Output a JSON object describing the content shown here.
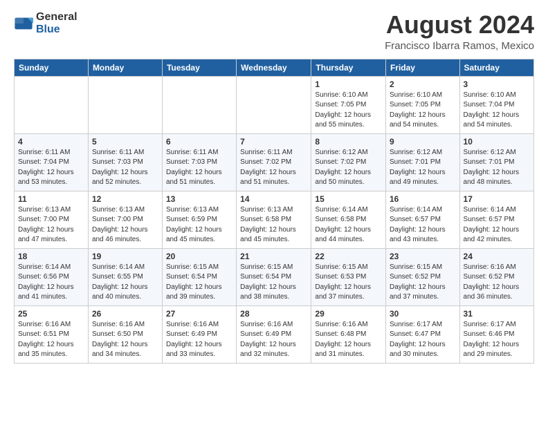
{
  "logo": {
    "general": "General",
    "blue": "Blue"
  },
  "title": "August 2024",
  "subtitle": "Francisco Ibarra Ramos, Mexico",
  "headers": [
    "Sunday",
    "Monday",
    "Tuesday",
    "Wednesday",
    "Thursday",
    "Friday",
    "Saturday"
  ],
  "weeks": [
    [
      {
        "day": "",
        "info": ""
      },
      {
        "day": "",
        "info": ""
      },
      {
        "day": "",
        "info": ""
      },
      {
        "day": "",
        "info": ""
      },
      {
        "day": "1",
        "info": "Sunrise: 6:10 AM\nSunset: 7:05 PM\nDaylight: 12 hours\nand 55 minutes."
      },
      {
        "day": "2",
        "info": "Sunrise: 6:10 AM\nSunset: 7:05 PM\nDaylight: 12 hours\nand 54 minutes."
      },
      {
        "day": "3",
        "info": "Sunrise: 6:10 AM\nSunset: 7:04 PM\nDaylight: 12 hours\nand 54 minutes."
      }
    ],
    [
      {
        "day": "4",
        "info": "Sunrise: 6:11 AM\nSunset: 7:04 PM\nDaylight: 12 hours\nand 53 minutes."
      },
      {
        "day": "5",
        "info": "Sunrise: 6:11 AM\nSunset: 7:03 PM\nDaylight: 12 hours\nand 52 minutes."
      },
      {
        "day": "6",
        "info": "Sunrise: 6:11 AM\nSunset: 7:03 PM\nDaylight: 12 hours\nand 51 minutes."
      },
      {
        "day": "7",
        "info": "Sunrise: 6:11 AM\nSunset: 7:02 PM\nDaylight: 12 hours\nand 51 minutes."
      },
      {
        "day": "8",
        "info": "Sunrise: 6:12 AM\nSunset: 7:02 PM\nDaylight: 12 hours\nand 50 minutes."
      },
      {
        "day": "9",
        "info": "Sunrise: 6:12 AM\nSunset: 7:01 PM\nDaylight: 12 hours\nand 49 minutes."
      },
      {
        "day": "10",
        "info": "Sunrise: 6:12 AM\nSunset: 7:01 PM\nDaylight: 12 hours\nand 48 minutes."
      }
    ],
    [
      {
        "day": "11",
        "info": "Sunrise: 6:13 AM\nSunset: 7:00 PM\nDaylight: 12 hours\nand 47 minutes."
      },
      {
        "day": "12",
        "info": "Sunrise: 6:13 AM\nSunset: 7:00 PM\nDaylight: 12 hours\nand 46 minutes."
      },
      {
        "day": "13",
        "info": "Sunrise: 6:13 AM\nSunset: 6:59 PM\nDaylight: 12 hours\nand 45 minutes."
      },
      {
        "day": "14",
        "info": "Sunrise: 6:13 AM\nSunset: 6:58 PM\nDaylight: 12 hours\nand 45 minutes."
      },
      {
        "day": "15",
        "info": "Sunrise: 6:14 AM\nSunset: 6:58 PM\nDaylight: 12 hours\nand 44 minutes."
      },
      {
        "day": "16",
        "info": "Sunrise: 6:14 AM\nSunset: 6:57 PM\nDaylight: 12 hours\nand 43 minutes."
      },
      {
        "day": "17",
        "info": "Sunrise: 6:14 AM\nSunset: 6:57 PM\nDaylight: 12 hours\nand 42 minutes."
      }
    ],
    [
      {
        "day": "18",
        "info": "Sunrise: 6:14 AM\nSunset: 6:56 PM\nDaylight: 12 hours\nand 41 minutes."
      },
      {
        "day": "19",
        "info": "Sunrise: 6:14 AM\nSunset: 6:55 PM\nDaylight: 12 hours\nand 40 minutes."
      },
      {
        "day": "20",
        "info": "Sunrise: 6:15 AM\nSunset: 6:54 PM\nDaylight: 12 hours\nand 39 minutes."
      },
      {
        "day": "21",
        "info": "Sunrise: 6:15 AM\nSunset: 6:54 PM\nDaylight: 12 hours\nand 38 minutes."
      },
      {
        "day": "22",
        "info": "Sunrise: 6:15 AM\nSunset: 6:53 PM\nDaylight: 12 hours\nand 37 minutes."
      },
      {
        "day": "23",
        "info": "Sunrise: 6:15 AM\nSunset: 6:52 PM\nDaylight: 12 hours\nand 37 minutes."
      },
      {
        "day": "24",
        "info": "Sunrise: 6:16 AM\nSunset: 6:52 PM\nDaylight: 12 hours\nand 36 minutes."
      }
    ],
    [
      {
        "day": "25",
        "info": "Sunrise: 6:16 AM\nSunset: 6:51 PM\nDaylight: 12 hours\nand 35 minutes."
      },
      {
        "day": "26",
        "info": "Sunrise: 6:16 AM\nSunset: 6:50 PM\nDaylight: 12 hours\nand 34 minutes."
      },
      {
        "day": "27",
        "info": "Sunrise: 6:16 AM\nSunset: 6:49 PM\nDaylight: 12 hours\nand 33 minutes."
      },
      {
        "day": "28",
        "info": "Sunrise: 6:16 AM\nSunset: 6:49 PM\nDaylight: 12 hours\nand 32 minutes."
      },
      {
        "day": "29",
        "info": "Sunrise: 6:16 AM\nSunset: 6:48 PM\nDaylight: 12 hours\nand 31 minutes."
      },
      {
        "day": "30",
        "info": "Sunrise: 6:17 AM\nSunset: 6:47 PM\nDaylight: 12 hours\nand 30 minutes."
      },
      {
        "day": "31",
        "info": "Sunrise: 6:17 AM\nSunset: 6:46 PM\nDaylight: 12 hours\nand 29 minutes."
      }
    ]
  ]
}
